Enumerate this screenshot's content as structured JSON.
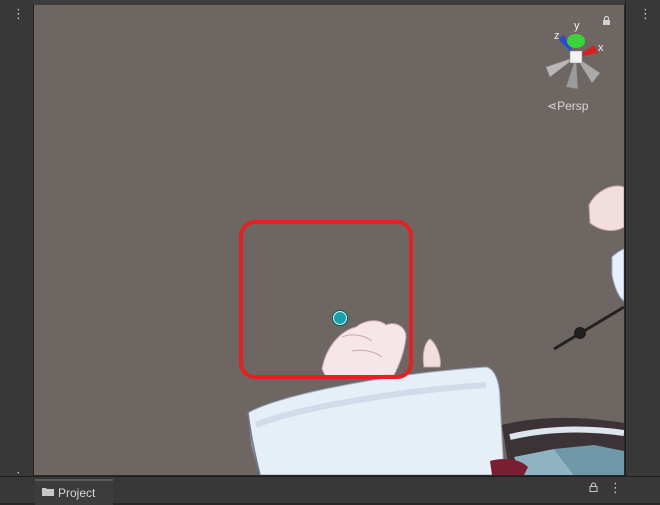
{
  "scene_view": {
    "projection_label": "Persp",
    "axis_labels": {
      "x": "x",
      "y": "y",
      "z": "z"
    },
    "colors": {
      "background": "#6e6662",
      "highlight": "#e22222",
      "handle": "#1aa0a8"
    }
  },
  "bottom_panel": {
    "tab_label": "Project"
  }
}
